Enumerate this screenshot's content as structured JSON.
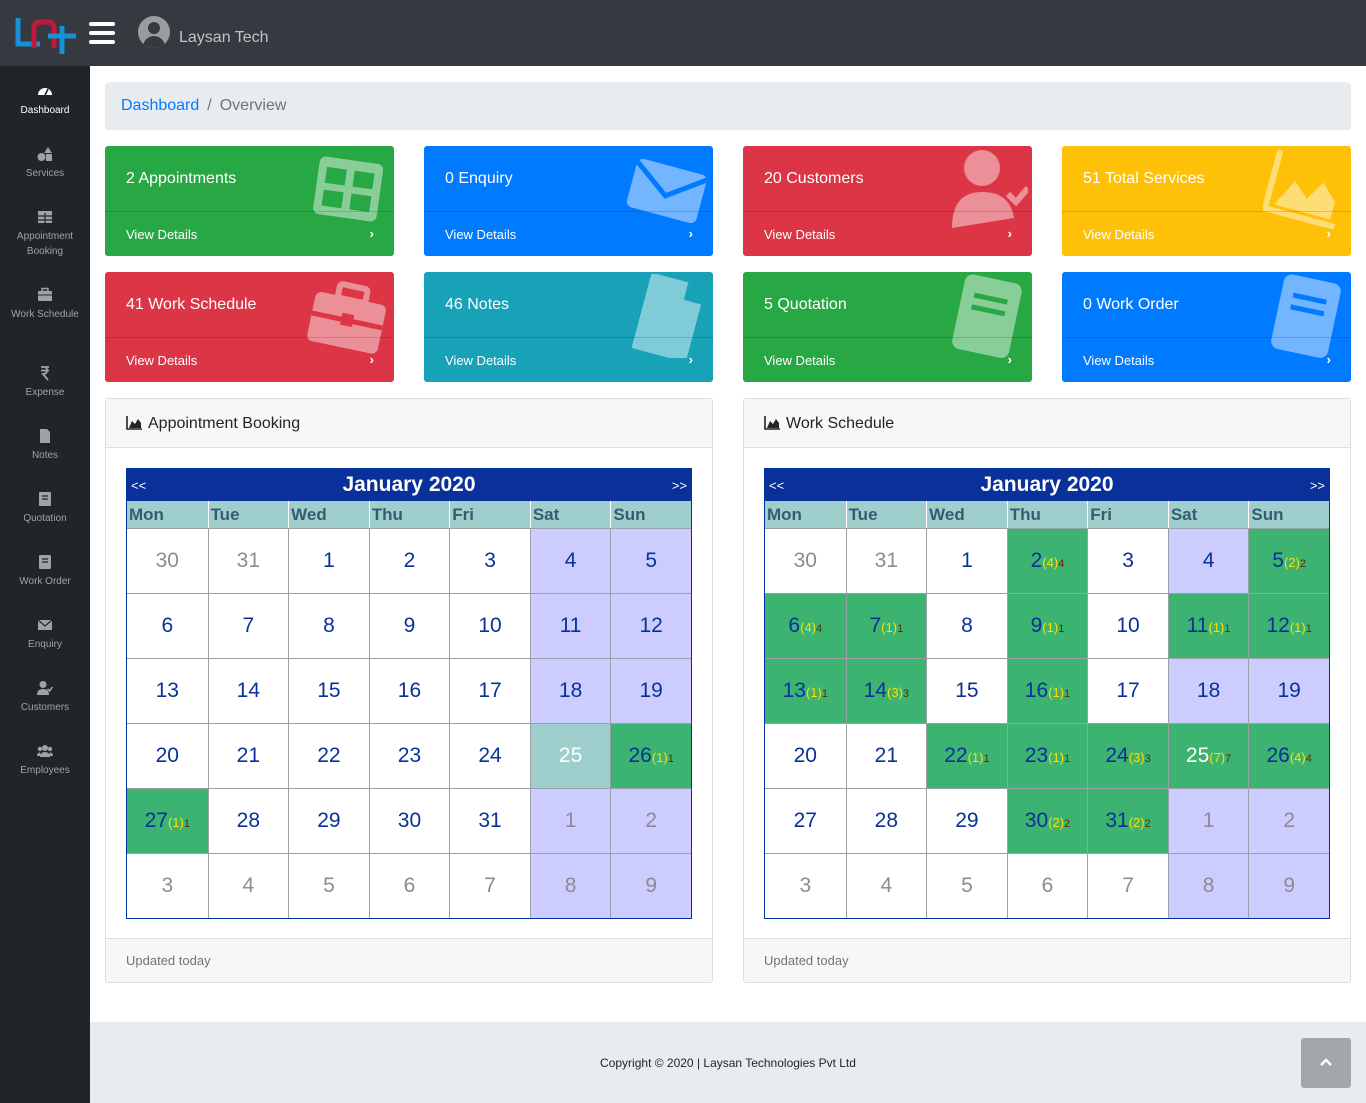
{
  "header": {
    "user_name": "Laysan Tech"
  },
  "sidebar": {
    "items": [
      {
        "label": "Dashboard",
        "icon": "dashboard-gauge-icon"
      },
      {
        "label": "Services",
        "icon": "shapes-icon"
      },
      {
        "label": "Appointment Booking",
        "icon": "table-grid-icon"
      },
      {
        "label": "Work Schedule",
        "icon": "briefcase-icon"
      },
      {
        "label": "Expense",
        "icon": "rupee-icon"
      },
      {
        "label": "Notes",
        "icon": "file-icon"
      },
      {
        "label": "Quotation",
        "icon": "book-icon"
      },
      {
        "label": "Work Order",
        "icon": "book-icon"
      },
      {
        "label": "Enquiry",
        "icon": "envelope-icon"
      },
      {
        "label": "Customers",
        "icon": "user-check-icon"
      },
      {
        "label": "Employees",
        "icon": "users-icon"
      }
    ]
  },
  "breadcrumb": {
    "link": "Dashboard",
    "separator": "/",
    "current": "Overview"
  },
  "cards": [
    {
      "title": "2 Appointments",
      "link": "View Details",
      "chevron": "›",
      "color": "#28a745",
      "icon": "table-grid-icon"
    },
    {
      "title": "0 Enquiry",
      "link": "View Details",
      "chevron": "›",
      "color": "#007bff",
      "icon": "envelope-icon"
    },
    {
      "title": "20 Customers",
      "link": "View Details",
      "chevron": "›",
      "color": "#dc3545",
      "icon": "user-check-icon"
    },
    {
      "title": "51 Total Services",
      "link": "View Details",
      "chevron": "›",
      "color": "#ffc107",
      "icon": "area-chart-icon"
    },
    {
      "title": "41 Work Schedule",
      "link": "View Details",
      "chevron": "›",
      "color": "#dc3545",
      "icon": "briefcase-icon"
    },
    {
      "title": "46 Notes",
      "link": "View Details",
      "chevron": "›",
      "color": "#17a2b8",
      "icon": "file-icon"
    },
    {
      "title": "5 Quotation",
      "link": "View Details",
      "chevron": "›",
      "color": "#28a745",
      "icon": "book-icon"
    },
    {
      "title": "0 Work Order",
      "link": "View Details",
      "chevron": "›",
      "color": "#007bff",
      "icon": "book-icon"
    }
  ],
  "panels": {
    "appointment": {
      "title": "Appointment Booking",
      "footer": "Updated today"
    },
    "schedule": {
      "title": "Work Schedule",
      "footer": "Updated today"
    }
  },
  "calendar": {
    "month_label": "January 2020",
    "prev": "<<",
    "next": ">>",
    "weekdays": [
      "Mon",
      "Tue",
      "Wed",
      "Thu",
      "Fri",
      "Sat",
      "Sun"
    ],
    "weeks": [
      [
        "30",
        "31",
        "1",
        "2",
        "3",
        "4",
        "5"
      ],
      [
        "6",
        "7",
        "8",
        "9",
        "10",
        "11",
        "12"
      ],
      [
        "13",
        "14",
        "15",
        "16",
        "17",
        "18",
        "19"
      ],
      [
        "20",
        "21",
        "22",
        "23",
        "24",
        "25",
        "26"
      ],
      [
        "27",
        "28",
        "29",
        "30",
        "31",
        "1",
        "2"
      ],
      [
        "3",
        "4",
        "5",
        "6",
        "7",
        "8",
        "9"
      ]
    ],
    "outside_month": {
      "first_week_before": 2,
      "trailing_from_week4_col": 5
    },
    "today": "25"
  },
  "appointment_events": [
    {
      "day": "26",
      "count": "(1)",
      "sub": "1"
    },
    {
      "day": "27",
      "count": "(1)",
      "sub": "1"
    }
  ],
  "schedule_events": [
    {
      "day": "2",
      "count": "(4)",
      "sub": "4"
    },
    {
      "day": "5",
      "count": "(2)",
      "sub": "2"
    },
    {
      "day": "6",
      "count": "(4)",
      "sub": "4"
    },
    {
      "day": "7",
      "count": "(1)",
      "sub": "1"
    },
    {
      "day": "9",
      "count": "(1)",
      "sub": "1"
    },
    {
      "day": "11",
      "count": "(1)",
      "sub": "1"
    },
    {
      "day": "12",
      "count": "(1)",
      "sub": "1"
    },
    {
      "day": "13",
      "count": "(1)",
      "sub": "1"
    },
    {
      "day": "14",
      "count": "(3)",
      "sub": "3"
    },
    {
      "day": "16",
      "count": "(1)",
      "sub": "1"
    },
    {
      "day": "22",
      "count": "(1)",
      "sub": "1"
    },
    {
      "day": "23",
      "count": "(1)",
      "sub": "1"
    },
    {
      "day": "24",
      "count": "(3)",
      "sub": "3"
    },
    {
      "day": "25",
      "count": "(7)",
      "sub": "7"
    },
    {
      "day": "26",
      "count": "(4)",
      "sub": "4"
    },
    {
      "day": "30",
      "count": "(2)",
      "sub": "2"
    },
    {
      "day": "31",
      "count": "(2)",
      "sub": "2"
    }
  ],
  "footer": {
    "copyright": "Copyright © 2020 | Laysan Technologies Pvt Ltd"
  },
  "colors": {
    "navbar": "#343a40",
    "sidebar": "#212529",
    "calendar_header": "#0a3199",
    "event_cell": "#3cb371",
    "weekend_cell": "#ccccff"
  }
}
